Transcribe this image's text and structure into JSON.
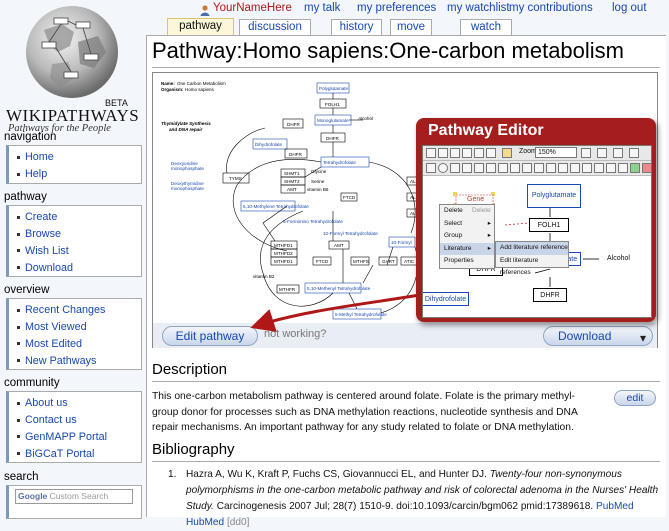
{
  "logo": {
    "beta": "BETA",
    "wordmark": "WIKIPATHWAYS",
    "tagline": "Pathways for the People"
  },
  "personal": {
    "user": "YourNameHere",
    "links": [
      "my talk",
      "my preferences",
      "my watchlist",
      "my contributions",
      "log out"
    ]
  },
  "tabs": [
    {
      "label": "pathway",
      "selected": true
    },
    {
      "label": "discussion",
      "selected": false
    },
    {
      "label": "history",
      "selected": false
    },
    {
      "label": "move",
      "selected": false
    },
    {
      "label": "watch",
      "selected": false
    }
  ],
  "sidebar": {
    "navigation": {
      "title": "navigation",
      "items": [
        "Home",
        "Help"
      ]
    },
    "pathway": {
      "title": "pathway",
      "items": [
        "Create",
        "Browse",
        "Wish List",
        "Download"
      ]
    },
    "overview": {
      "title": "overview",
      "items": [
        "Recent Changes",
        "Most Viewed",
        "Most Edited",
        "New Pathways"
      ]
    },
    "community": {
      "title": "community",
      "items": [
        "About us",
        "Contact us",
        "GenMAPP Portal",
        "BiGCaT Portal"
      ]
    },
    "search": {
      "title": "search",
      "placeholder": "Custom Search",
      "brand": "Google"
    }
  },
  "page": {
    "title": "Pathway:Homo sapiens:One-carbon metabolism",
    "edit_button": "Edit pathway",
    "not_working": "not working?",
    "download_button": "Download",
    "description_heading": "Description",
    "description_text": "This one-carbon metabolism pathway is centered around folate. Folate is the primary methyl-group donor for processes such as DNA methylation reactions, nucleotide synthesis and DNA repair mechanisms. An important pathway for any study related to folate or DNA methylation.",
    "edit_description": "edit",
    "bibliography_heading": "Bibliography",
    "bibliography": [
      {
        "number": "1.",
        "authors": "Hazra A, Wu K, Kraft P, Fuchs CS, Giovannucci EL, and Hunter DJ.",
        "title": "Twenty-four non-synonymous polymorphisms in the one-carbon metabolic pathway and risk of colorectal adenoma in the Nurses' Health Study.",
        "citation": "Carcinogenesis 2007 Jul; 28(7) 1510-9. doi:10.1093/carcin/bgm062 pmid:17389618.",
        "links": [
          "PubMed",
          "HubMed"
        ],
        "tag": "[dd0]"
      }
    ]
  },
  "diagram": {
    "header_name_label": "Name:",
    "header_name": "One Carbon Metabolism",
    "header_org_label": "Organism:",
    "header_org": "Homo sapiens",
    "labels": {
      "polyglutamate": "Polyglutamate",
      "folh1": "FOLH1",
      "alcohol": "Alcohol",
      "monoglutamate": "Monoglutamate",
      "dhfr": "DHFR",
      "dihydrofolate": "Dihydrofolate",
      "tetrahydrofolate": "Tetrahydrofolate",
      "thymidylate": "Thymidylate Synthesis",
      "dna_repair": "and DNA repair",
      "deoxyuridine": "Deoxyuridine",
      "deoxyuridine2": "monophosphate",
      "deoxythymidine": "Deoxythymidine",
      "deoxythymidine2": "monophosphate",
      "tyms": "TYMS",
      "shmt1": "SHMT1",
      "shmt2": "SHMT2",
      "amt": "AMT",
      "glycine": "Glycine",
      "serine": "Serine",
      "vitamin_b6": "vitamin B6",
      "ftcd": "FTCD",
      "methylene": "5,10-Methylene Tetrahydrofolate",
      "formimino": "5-Formimino Tetrahydrofolate",
      "formyl": "10-Formyl Tetrahydrofolate",
      "mthfd1": "MTHFD1",
      "mthfd2": "MTHFD2",
      "aminomethyl": "AMT",
      "gart": "GART",
      "methenyl": "5,10-Methenyl Tetrahydrofolate",
      "mthfr": "MTHFR",
      "vitamin_b2": "vitamin B2",
      "methyl": "5-Methyl Tetrahydrofolate",
      "formyl_short": "10-Formyl",
      "ald": "ALD",
      "mthfs": "MTHFS",
      "atic": "ATIC"
    }
  },
  "editor": {
    "title": "Pathway Editor",
    "zoom_label": "Zoom:",
    "zoom_value": "150%",
    "gene_label": "Gene",
    "menu": [
      {
        "label": "Delete",
        "hint": "Delete"
      },
      {
        "label": "Select"
      },
      {
        "label": "Group"
      },
      {
        "label": "Literature"
      },
      {
        "label": "Properties"
      }
    ],
    "submenu": [
      "Add literature reference",
      "Edit literature references"
    ],
    "nodes": {
      "polyglutamate": "Polyglutamate",
      "folh1": "FOLH1",
      "monoglutamate": "Monoglutamate",
      "alcohol": "Alcohol",
      "dhfr1": "DHFR",
      "dhfr2": "DHFR",
      "dihydrofolate": "Dihydrofolate"
    }
  },
  "colors": {
    "link": "#1848b0",
    "callout": "#a51e1e",
    "arrow": "#b01818"
  }
}
